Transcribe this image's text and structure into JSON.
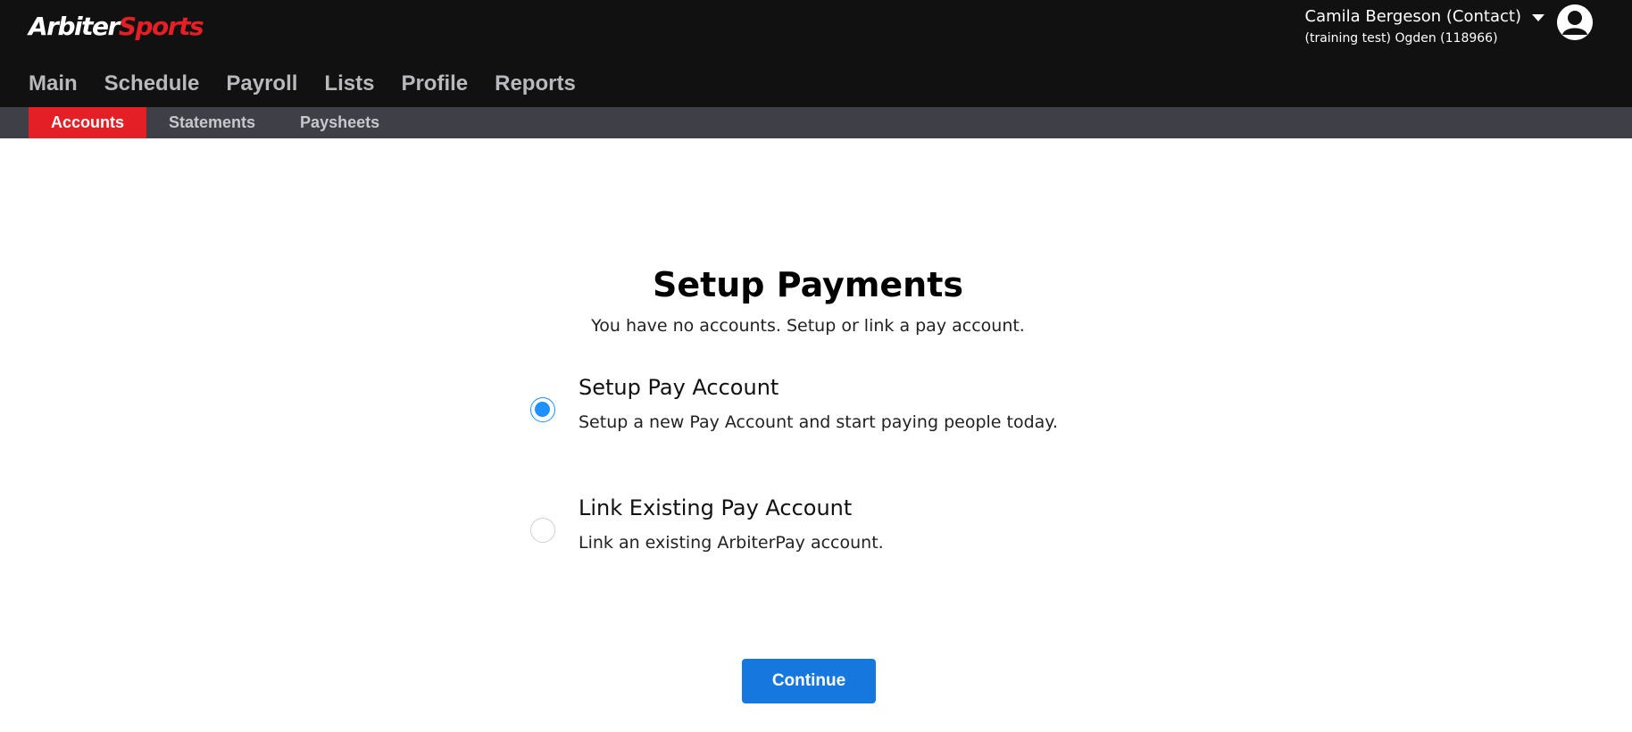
{
  "header": {
    "logo": {
      "part1": "Arbiter",
      "part2": "Sports"
    },
    "user": {
      "name": "Camila Bergeson (Contact)",
      "org": "(training test) Ogden (118966)"
    },
    "icons": {
      "dropdown": "caret-down-icon",
      "avatar": "user-avatar-icon"
    }
  },
  "main_nav": {
    "items": [
      {
        "label": "Main"
      },
      {
        "label": "Schedule"
      },
      {
        "label": "Payroll"
      },
      {
        "label": "Lists"
      },
      {
        "label": "Profile"
      },
      {
        "label": "Reports"
      }
    ]
  },
  "sub_nav": {
    "active": "Accounts",
    "items": [
      {
        "label": "Accounts"
      },
      {
        "label": "Statements"
      },
      {
        "label": "Paysheets"
      }
    ]
  },
  "content": {
    "title": "Setup Payments",
    "subtitle": "You have no accounts. Setup or link a pay account.",
    "options": [
      {
        "title": "Setup Pay Account",
        "description": "Setup a new Pay Account and start paying people today.",
        "selected": true
      },
      {
        "title": "Link Existing Pay Account",
        "description": "Link an existing ArbiterPay account.",
        "selected": false
      }
    ],
    "continue_label": "Continue"
  },
  "colors": {
    "header_bg": "#111111",
    "subnav_bg": "#3e3f47",
    "active_tab": "#e41f26",
    "radio_selected": "#1e90ff",
    "button": "#1678de"
  }
}
